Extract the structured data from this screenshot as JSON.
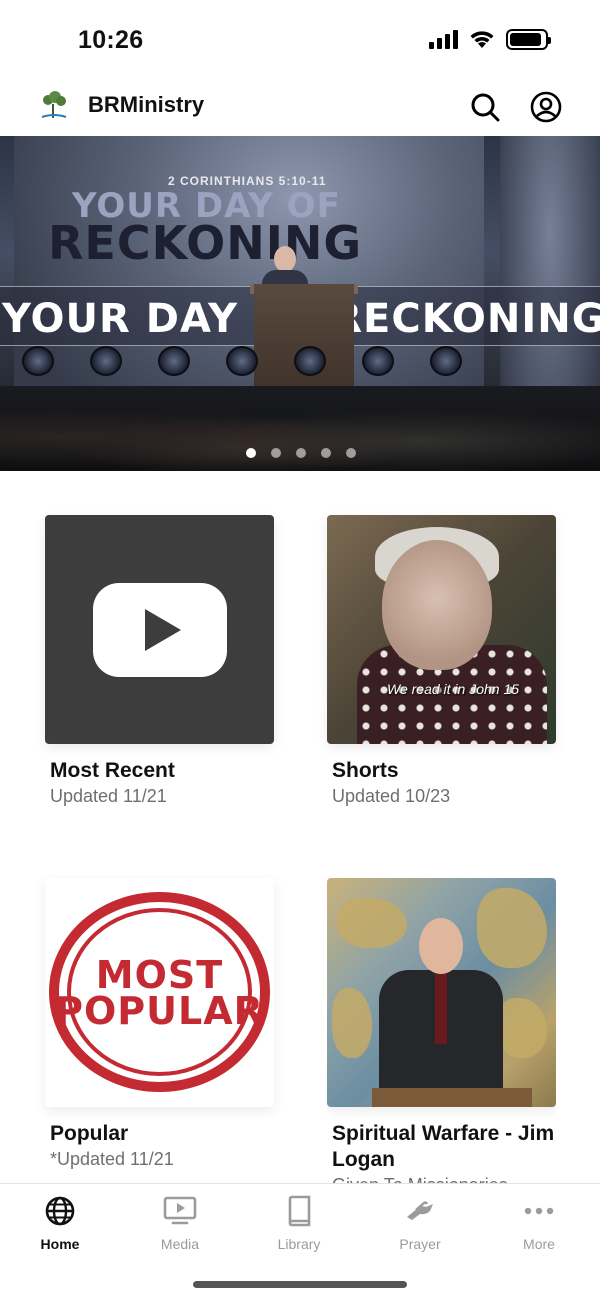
{
  "status_bar": {
    "time": "10:26",
    "signal_icon": "signal-icon",
    "wifi_icon": "wifi-icon",
    "battery_icon": "battery-icon",
    "battery_level": 0.9
  },
  "header": {
    "app_name": "BRMinistry",
    "logo_icon": "tree-logo-icon",
    "search_icon": "search-icon",
    "profile_icon": "profile-icon"
  },
  "hero": {
    "scripture_ref": "2 CORINTHIANS 5:10-11",
    "title_line1": "YOUR DAY OF",
    "title_line2": "RECKONING",
    "band_text": "YOUR DAY OF RECKONING",
    "slide_count": 5,
    "active_slide": 1
  },
  "cards": [
    {
      "title": "Most Recent",
      "subtitle": "Updated 11/21",
      "thumbnail_icon": "youtube-play-icon"
    },
    {
      "title": "Shorts",
      "subtitle": "Updated 10/23",
      "thumbnail_caption": "We read it in John 15"
    },
    {
      "title": "Popular",
      "subtitle": "*Updated 11/21",
      "stamp_line1": "MOST",
      "stamp_line2": "POPULAR"
    },
    {
      "title": "Spiritual Warfare - Jim Logan",
      "subtitle": "Given To Missionaries"
    }
  ],
  "tabs": [
    {
      "label": "Home",
      "icon": "globe-icon",
      "active": true
    },
    {
      "label": "Media",
      "icon": "media-icon",
      "active": false
    },
    {
      "label": "Library",
      "icon": "book-icon",
      "active": false
    },
    {
      "label": "Prayer",
      "icon": "praying-hands-icon",
      "active": false
    },
    {
      "label": "More",
      "icon": "more-dots-icon",
      "active": false
    }
  ],
  "colors": {
    "accent": "#111111",
    "inactive_tab": "#9b9b9b",
    "subtitle": "#6f6f6f",
    "stamp_red": "#c42a32"
  }
}
